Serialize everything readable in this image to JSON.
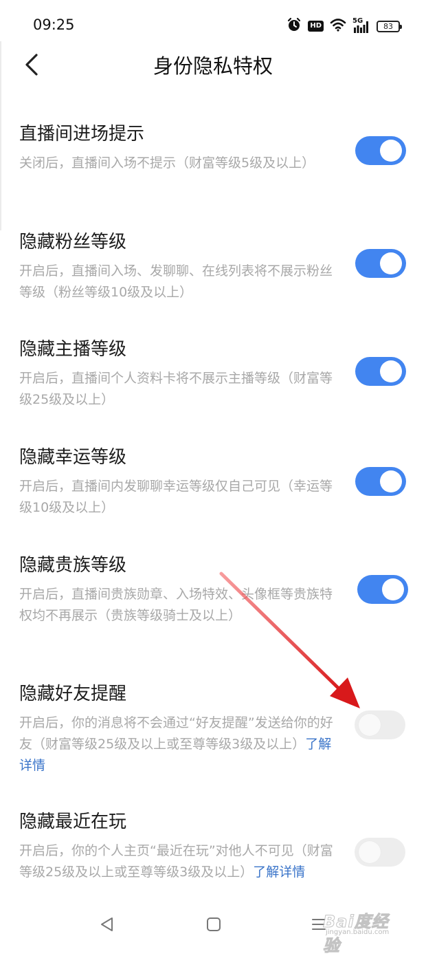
{
  "status_bar": {
    "time": "09:25",
    "hd_label": "HD",
    "network_label": "5G",
    "battery": "83"
  },
  "header": {
    "title": "身份隐私特权"
  },
  "settings": [
    {
      "title": "直播间进场提示",
      "desc": "关闭后，直播间入场不提示（财富等级5级及以上）",
      "enabled": true
    },
    {
      "title": "隐藏粉丝等级",
      "desc": "开启后，直播间入场、发聊聊、在线列表将不展示粉丝等级（粉丝等级10级及以上）",
      "enabled": true
    },
    {
      "title": "隐藏主播等级",
      "desc": "开启后，直播间个人资料卡将不展示主播等级（财富等级25级及以上）",
      "enabled": true
    },
    {
      "title": "隐藏幸运等级",
      "desc": "开启后，直播间内发聊聊幸运等级仅自己可见（幸运等级10级及以上）",
      "enabled": true
    },
    {
      "title": "隐藏贵族等级",
      "desc": "开启后，直播间贵族勋章、入场特效、头像框等贵族特权均不再展示（贵族等级骑士及以上）",
      "enabled": true
    },
    {
      "title": "隐藏好友提醒",
      "desc": "开启后，你的消息将不会通过“好友提醒”发送给你的好友（财富等级25级及以上或至尊等级3级及以上）",
      "link": "了解详情",
      "enabled": false
    },
    {
      "title": "隐藏最近在玩",
      "desc": "开启后，你的个人主页“最近在玩”对他人不可见（财富等级25级及以上或至尊等级3级及以上）",
      "link": "了解详情",
      "enabled": false
    }
  ],
  "colors": {
    "toggle_on": "#4285f0",
    "toggle_off": "#ededed",
    "link": "#3a74c9",
    "annotation_arrow": "#e0191b"
  },
  "icons": {
    "back": "chevron-left-icon",
    "alarm": "alarm-icon",
    "wifi": "wifi-icon",
    "signal": "signal-icon",
    "nav_back": "triangle-back-icon",
    "nav_home": "square-home-icon",
    "nav_menu": "menu-lines-icon"
  },
  "watermark": {
    "main": "Bai度经验",
    "sub": "jingyan.baidu.com"
  }
}
